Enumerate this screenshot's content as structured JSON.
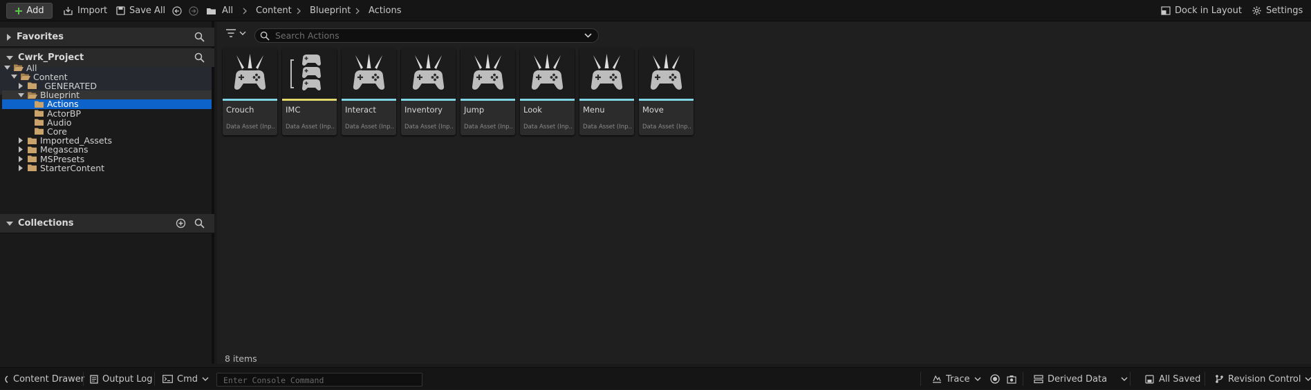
{
  "toolbar": {
    "add_label": "Add",
    "import_label": "Import",
    "save_all_label": "Save All",
    "dock_label": "Dock in Layout",
    "settings_label": "Settings"
  },
  "breadcrumb": [
    "All",
    "Content",
    "Blueprint",
    "Actions"
  ],
  "sidebar": {
    "favorites_title": "Favorites",
    "project_title": "Cwrk_Project",
    "collections_title": "Collections",
    "tree": [
      {
        "label": "All",
        "depth": 0,
        "state": "expanded"
      },
      {
        "label": "Content",
        "depth": 1,
        "state": "expanded"
      },
      {
        "label": "_GENERATED",
        "depth": 2,
        "state": "collapsed"
      },
      {
        "label": "Blueprint",
        "depth": 2,
        "state": "expanded"
      },
      {
        "label": "Actions",
        "depth": 3,
        "state": "leaf"
      },
      {
        "label": "ActorBP",
        "depth": 3,
        "state": "leaf"
      },
      {
        "label": "Audio",
        "depth": 3,
        "state": "leaf"
      },
      {
        "label": "Core",
        "depth": 3,
        "state": "leaf"
      },
      {
        "label": "Imported_Assets",
        "depth": 2,
        "state": "collapsed"
      },
      {
        "label": "Megascans",
        "depth": 2,
        "state": "collapsed"
      },
      {
        "label": "MSPresets",
        "depth": 2,
        "state": "collapsed"
      },
      {
        "label": "StarterContent",
        "depth": 2,
        "state": "collapsed"
      }
    ]
  },
  "search": {
    "placeholder": "Search Actions"
  },
  "assets": [
    {
      "name": "Crouch",
      "subtitle": "Data Asset (Inp...",
      "icon": "gamepad-icon"
    },
    {
      "name": "IMC",
      "subtitle": "Data Asset (Inp...",
      "icon": "mapping-context-icon"
    },
    {
      "name": "Interact",
      "subtitle": "Data Asset (Inp...",
      "icon": "gamepad-icon"
    },
    {
      "name": "Inventory",
      "subtitle": "Data Asset (Inp...",
      "icon": "gamepad-icon"
    },
    {
      "name": "Jump",
      "subtitle": "Data Asset (Inp...",
      "icon": "gamepad-icon"
    },
    {
      "name": "Look",
      "subtitle": "Data Asset (Inp...",
      "icon": "gamepad-icon"
    },
    {
      "name": "Menu",
      "subtitle": "Data Asset (Inp...",
      "icon": "gamepad-icon"
    },
    {
      "name": "Move",
      "subtitle": "Data Asset (Inp...",
      "icon": "gamepad-icon"
    }
  ],
  "item_count": "8 items",
  "status_bar": {
    "content_drawer": "Content Drawer",
    "output_log": "Output Log",
    "cmd": "Cmd",
    "console_placeholder": "Enter Console Command",
    "trace": "Trace",
    "derived_data": "Derived Data",
    "all_saved": "All Saved",
    "revision_control": "Revision Control"
  },
  "colors": {
    "selection": "#0d63c9",
    "action_accent": "#7fd7e6",
    "mapping_accent": "#e2d96a",
    "folder": "#c9a36a"
  }
}
